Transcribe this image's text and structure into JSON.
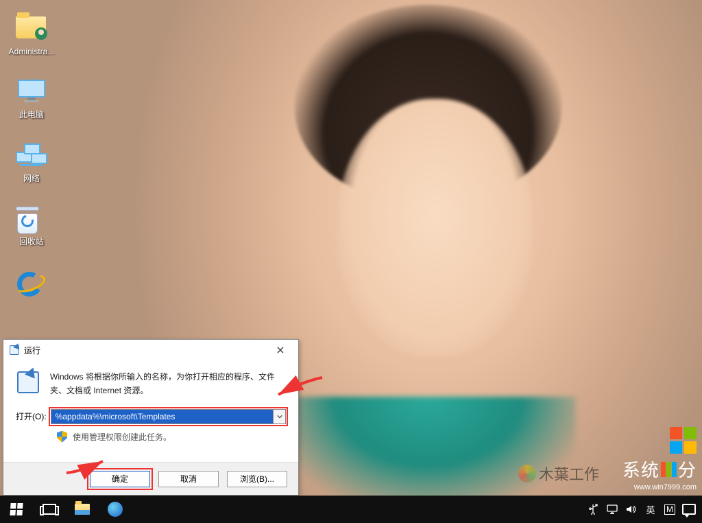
{
  "desktop": {
    "icons": [
      {
        "id": "admin-folder",
        "label": "Administra..."
      },
      {
        "id": "this-pc",
        "label": "此电脑"
      },
      {
        "id": "network",
        "label": "网络"
      },
      {
        "id": "recycle-bin",
        "label": "回收站"
      },
      {
        "id": "internet-explorer",
        "label": ""
      }
    ]
  },
  "run_dialog": {
    "title": "运行",
    "description": "Windows 将根据你所输入的名称，为你打开相应的程序、文件夹、文档或 Internet 资源。",
    "open_label": "打开(O):",
    "open_value": "%appdata%\\microsoft\\Templates",
    "admin_note": "使用管理权限创建此任务。",
    "buttons": {
      "ok": "确定",
      "cancel": "取消",
      "browse": "浏览(B)..."
    }
  },
  "taskbar": {
    "tray": {
      "ime_lang": "英",
      "ime_mode": "M"
    }
  },
  "watermarks": {
    "muye": "木葉工作",
    "brand_prefix": "系统",
    "brand_suffix": "分",
    "url": "www.win7999.com"
  }
}
